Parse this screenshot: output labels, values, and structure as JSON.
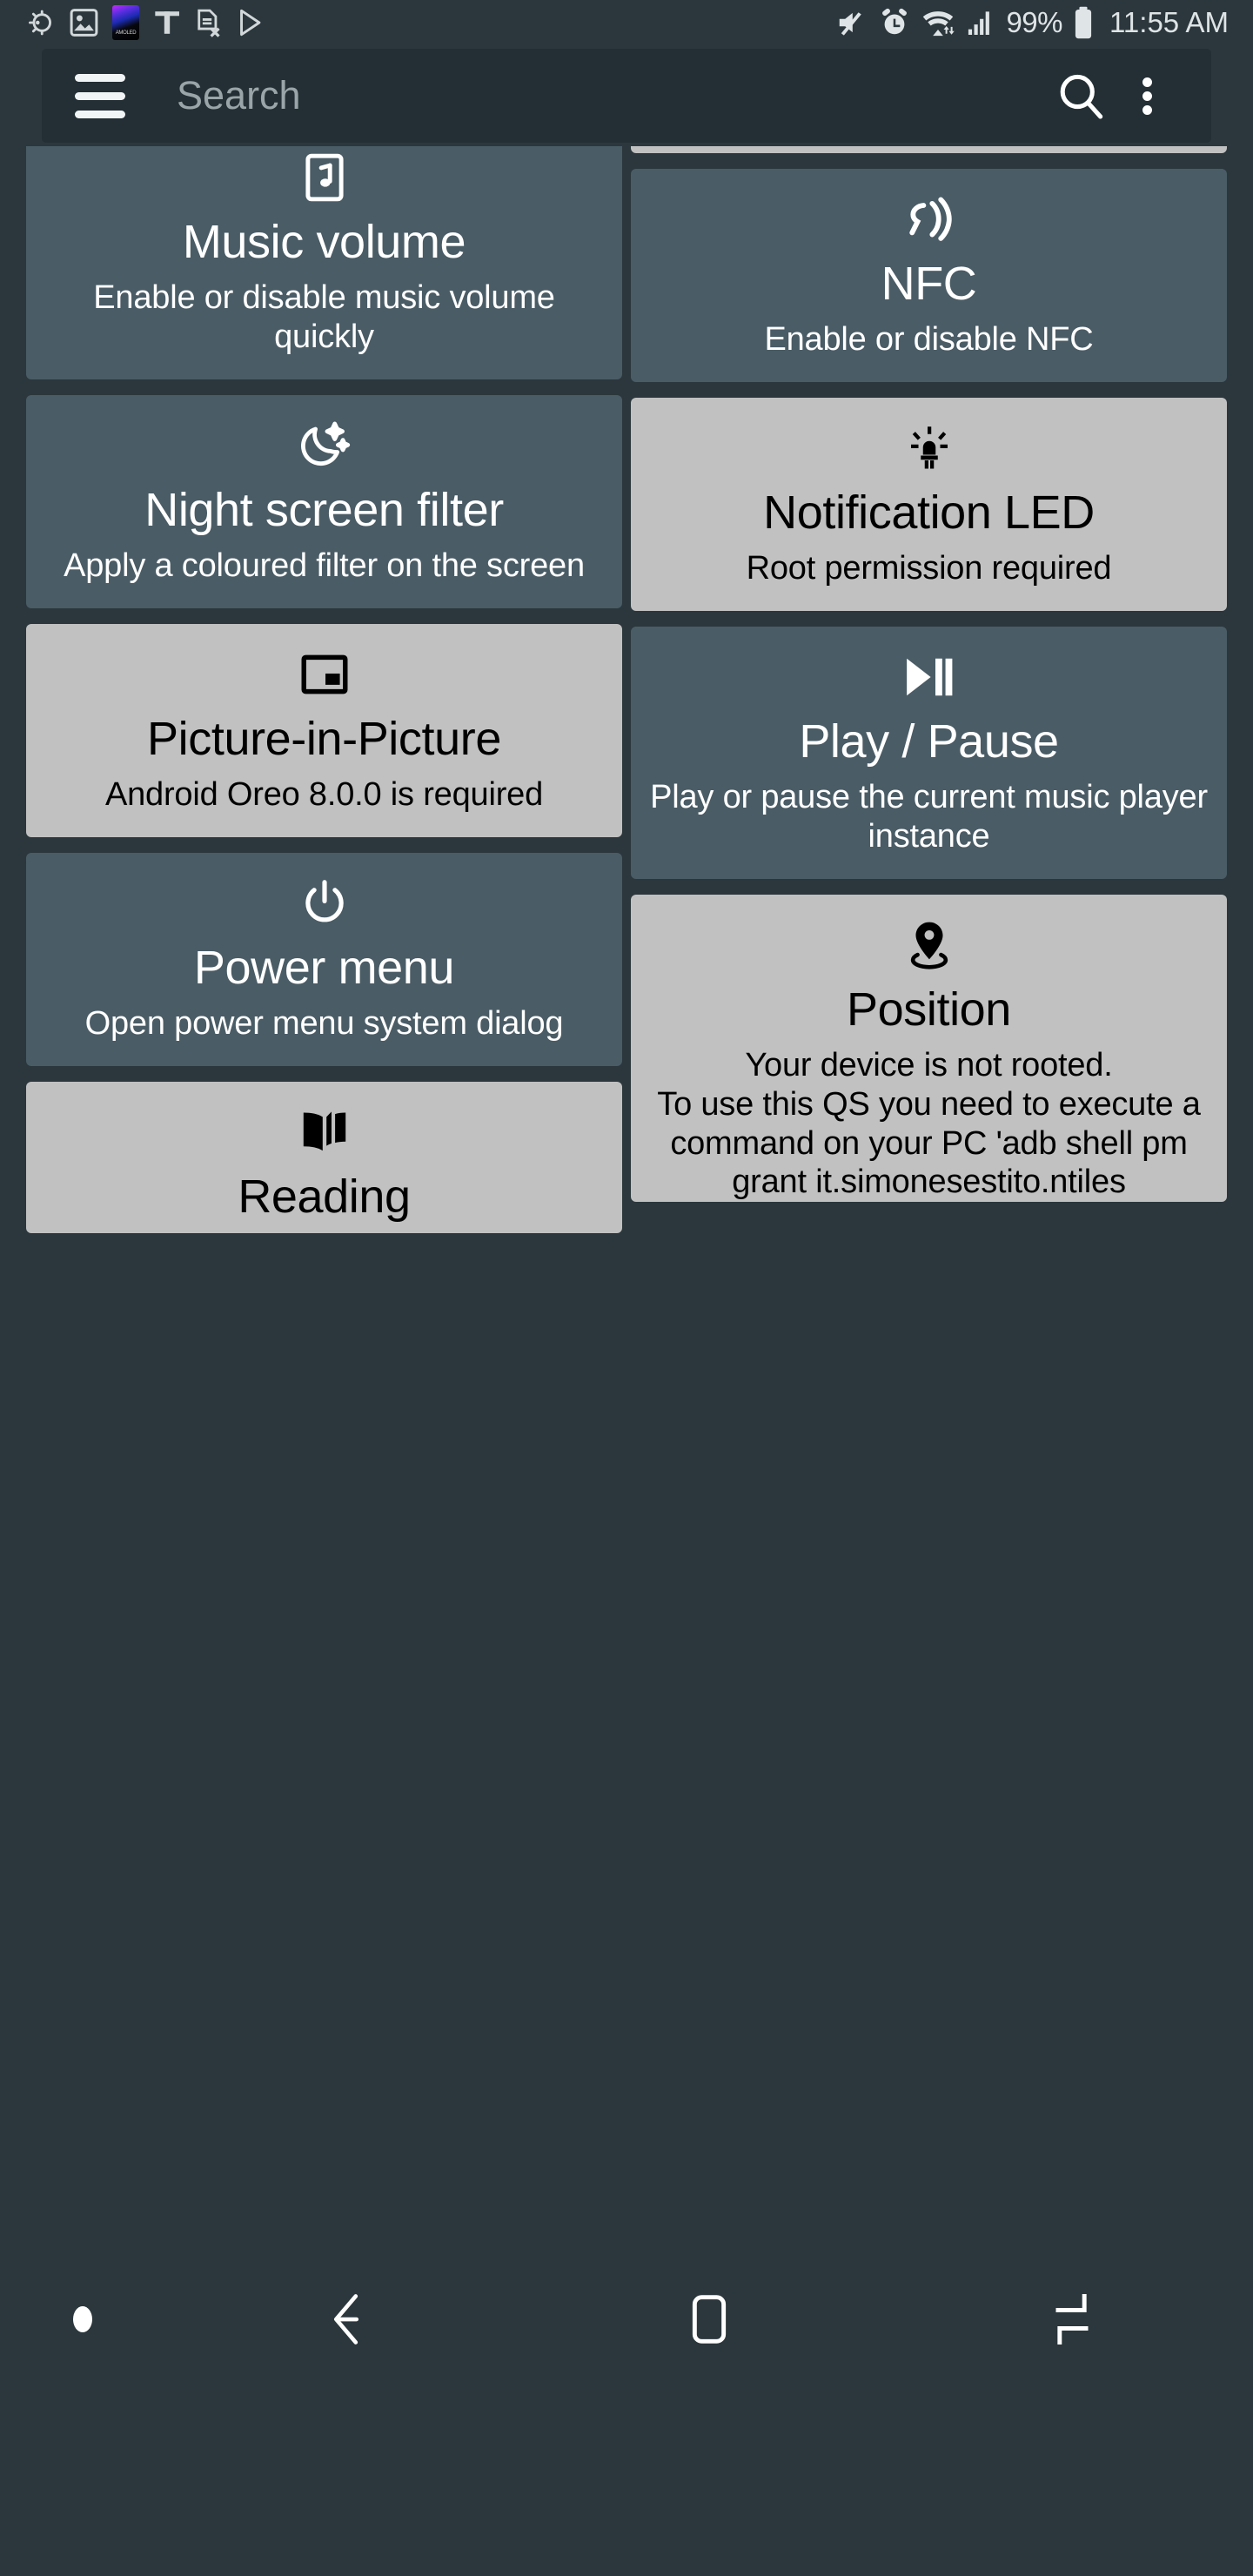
{
  "status_bar": {
    "left_icons": [
      "brightness-auto-icon",
      "gallery-icon",
      "amoled-app-icon",
      "t-mobile-icon",
      "sim-card-off-icon",
      "play-store-icon"
    ],
    "right_icons": [
      "mute-icon",
      "alarm-icon",
      "wifi-icon",
      "signal-icon"
    ],
    "battery_percent": "99%",
    "battery_icon": "battery-full-icon",
    "time": "11:55 AM"
  },
  "app_bar": {
    "menu_icon": "hamburger-menu-icon",
    "search_placeholder": "Search",
    "search_value": "",
    "search_icon": "search-icon",
    "overflow_icon": "more-vertical-icon"
  },
  "tiles": {
    "left_column": [
      {
        "id": "music-volume",
        "title": "Music volume",
        "subtitle": "Enable or disable music volume quickly",
        "icon": "music-note-box-icon",
        "theme": "dark"
      },
      {
        "id": "night-screen-filter",
        "title": "Night screen filter",
        "subtitle": "Apply a coloured filter on the screen",
        "icon": "moon-stars-icon",
        "theme": "dark"
      },
      {
        "id": "picture-in-picture",
        "title": "Picture-in-Picture",
        "subtitle": "Android Oreo 8.0.0 is required",
        "icon": "picture-in-picture-icon",
        "theme": "light"
      },
      {
        "id": "power-menu",
        "title": "Power menu",
        "subtitle": "Open power menu system dialog",
        "icon": "power-icon",
        "theme": "dark"
      },
      {
        "id": "reading",
        "title": "Reading",
        "subtitle": "",
        "icon": "open-book-icon",
        "theme": "light"
      }
    ],
    "right_column": [
      {
        "id": "nfc",
        "title": "NFC",
        "subtitle": "Enable or disable NFC",
        "icon": "nfc-icon",
        "theme": "dark"
      },
      {
        "id": "notification-led",
        "title": "Notification LED",
        "subtitle": "Root permission required",
        "icon": "led-bulb-icon",
        "theme": "light"
      },
      {
        "id": "play-pause",
        "title": "Play / Pause",
        "subtitle": "Play or pause the current music player instance",
        "icon": "play-pause-icon",
        "theme": "dark"
      },
      {
        "id": "position",
        "title": "Position",
        "subtitle": "Your device is not rooted.\nTo use this QS you need to execute a command on your PC 'adb shell pm grant it.simonesestito.ntiles",
        "icon": "location-pin-icon",
        "theme": "light"
      }
    ]
  },
  "nav_bar": {
    "items": [
      {
        "id": "nav-indicator",
        "icon": "dot-indicator-icon"
      },
      {
        "id": "nav-back",
        "icon": "back-arrow-icon"
      },
      {
        "id": "nav-home",
        "icon": "home-square-icon"
      },
      {
        "id": "nav-recents",
        "icon": "recents-icon"
      }
    ]
  },
  "colors": {
    "app_background": "#2b373c",
    "app_bar": "#232f34",
    "tile_dark": "#4a5c66",
    "tile_light": "#c1c1c1",
    "text_on_dark": "#ffffff",
    "text_on_light": "#000000",
    "status_text": "#dfe4e6"
  }
}
